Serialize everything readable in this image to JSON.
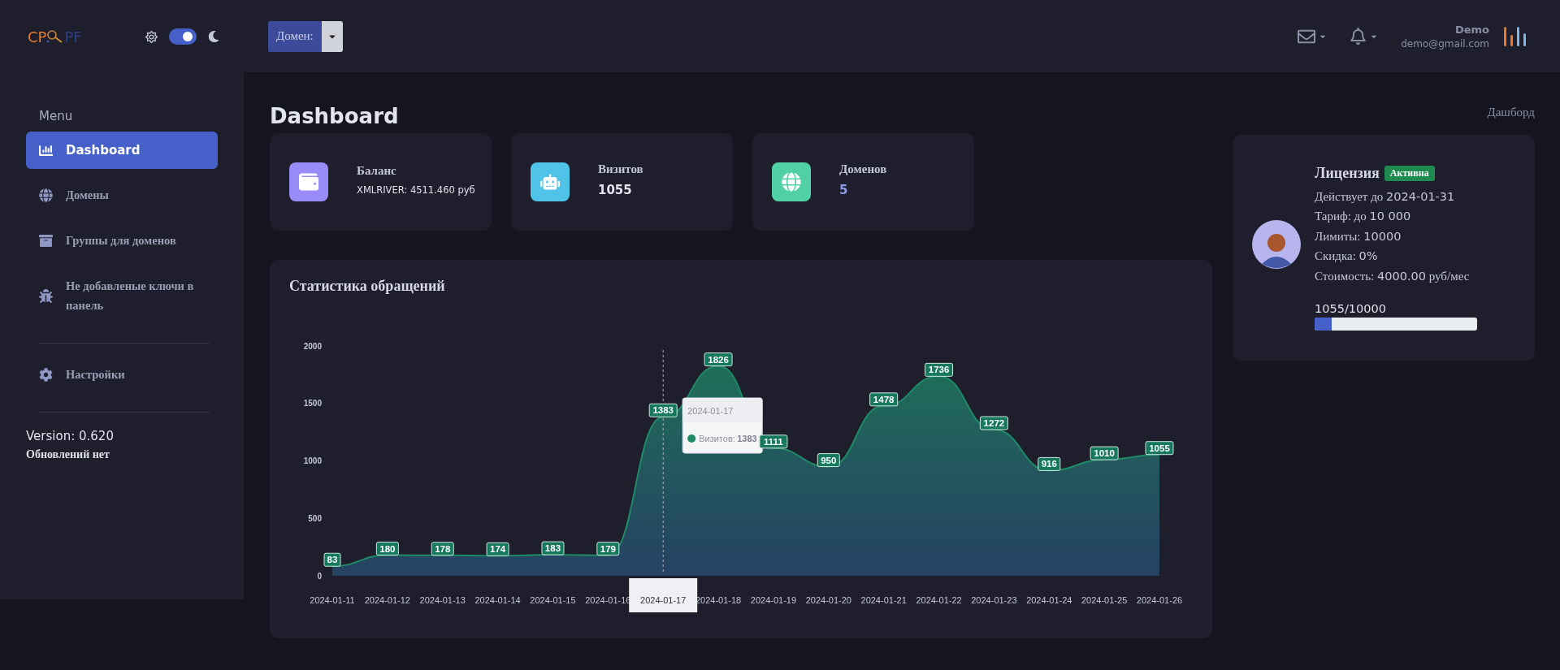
{
  "header": {
    "logo_left": "CP",
    "logo_right": "PF",
    "theme_toggle": {
      "on": true
    },
    "domain_button": "Домен:",
    "user_name": "Demo",
    "user_email": "demo@gmail.com"
  },
  "sidebar": {
    "heading": "Menu",
    "items": [
      {
        "label": "Dashboard",
        "selected": true
      },
      {
        "label": "Домены",
        "selected": false
      },
      {
        "label": "Группы для доменов",
        "selected": false
      },
      {
        "label": "Не добавленые ключи в панель",
        "selected": false
      }
    ],
    "bottom_items": [
      {
        "label": "Настройки",
        "selected": false
      }
    ],
    "version": "Version: 0.620",
    "updates": "Обновлений нет"
  },
  "page": {
    "title": "Dashboard",
    "breadcrumb": "Дашборд"
  },
  "stats": [
    {
      "title": "Баланс",
      "value": "XMLRIVER: 4511.460 руб",
      "kind": "small",
      "color": "#9a8cf8"
    },
    {
      "title": "Визитов",
      "value": "1055",
      "kind": "bold",
      "color": "#4fc3e8"
    },
    {
      "title": "Доменов",
      "value": "5",
      "kind": "accent",
      "color": "#4fd1a5"
    }
  ],
  "chart": {
    "title": "Статистика обращений",
    "tooltip": {
      "date": "2024-01-17",
      "series": "Визитов:",
      "value": "1383"
    },
    "axis_tooltip": "2024-01-17",
    "chart_data": {
      "type": "area",
      "categories": [
        "2024-01-11",
        "2024-01-12",
        "2024-01-13",
        "2024-01-14",
        "2024-01-15",
        "2024-01-16",
        "2024-01-17",
        "2024-01-18",
        "2024-01-19",
        "2024-01-20",
        "2024-01-21",
        "2024-01-22",
        "2024-01-23",
        "2024-01-24",
        "2024-01-25",
        "2024-01-26"
      ],
      "series": [
        {
          "color": "#1f8a66",
          "values": [
            83,
            180,
            178,
            174,
            183,
            179,
            1383,
            1826,
            1111,
            950,
            1478,
            1736,
            1272,
            916,
            1010,
            1055
          ]
        }
      ],
      "yticks": [
        0,
        500,
        1000,
        1500,
        2000
      ],
      "ylim": [
        0,
        2000
      ],
      "data_labels": true
    }
  },
  "license": {
    "title": "Лицензия",
    "badge": "Активна",
    "lines": [
      {
        "label": "Действует до",
        "value": "2024-01-31"
      },
      {
        "label": "Тариф: до",
        "value": "10 000"
      },
      {
        "label": "Лимиты:",
        "value": "10000"
      },
      {
        "label": "Скидка:",
        "value": "0%"
      },
      {
        "label": "Стоимость:",
        "value": "4000.00",
        "unit": "руб/мес"
      }
    ],
    "usage": "1055/10000",
    "level": 0.1055
  }
}
